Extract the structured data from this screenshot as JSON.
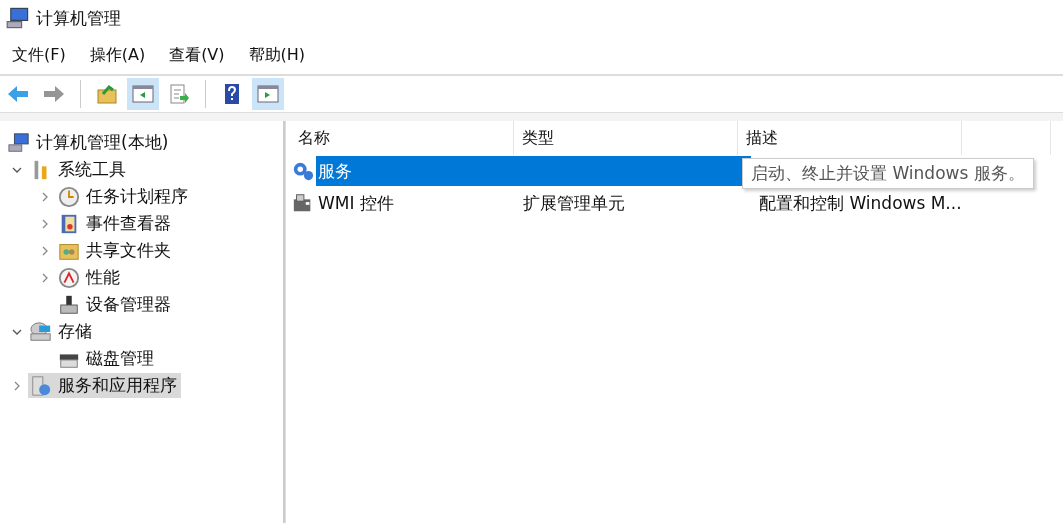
{
  "window": {
    "title": "计算机管理"
  },
  "menu": [
    "文件(F)",
    "操作(A)",
    "查看(V)",
    "帮助(H)"
  ],
  "toolbar": [
    {
      "disabled": false,
      "pressed": false
    },
    {
      "disabled": true,
      "pressed": false
    },
    {
      "disabled": false,
      "pressed": false
    },
    {
      "disabled": false,
      "pressed": true
    },
    {
      "disabled": false,
      "pressed": false
    },
    {
      "disabled": false,
      "pressed": false
    },
    {
      "disabled": false,
      "pressed": true
    }
  ],
  "tree": [
    {
      "label": "计算机管理(本地)",
      "selected": false,
      "children": [
        {
          "label": "系统工具",
          "expanded": true,
          "selected": false,
          "children": [
            {
              "label": "任务计划程序",
              "expanded": false,
              "selected": false
            },
            {
              "label": "事件查看器",
              "expanded": false,
              "selected": false
            },
            {
              "label": "共享文件夹",
              "expanded": false,
              "selected": false
            },
            {
              "label": "性能",
              "expanded": false,
              "selected": false
            },
            {
              "label": "设备管理器",
              "selected": false
            }
          ]
        },
        {
          "label": "存储",
          "expanded": true,
          "selected": false,
          "children": [
            {
              "label": "磁盘管理",
              "selected": false
            }
          ]
        },
        {
          "label": "服务和应用程序",
          "expanded": false,
          "selected": true
        }
      ]
    }
  ],
  "table": {
    "columns": [
      "名称",
      "类型",
      "描述"
    ],
    "rows": [
      {
        "name": "服务",
        "selected": true
      },
      {
        "name": "WMI 控件",
        "type": "扩展管理单元",
        "description": "配置和控制 Windows M...",
        "selected": false
      }
    ]
  },
  "tooltip": {
    "text": "启动、终止并设置 Windows 服务。"
  }
}
